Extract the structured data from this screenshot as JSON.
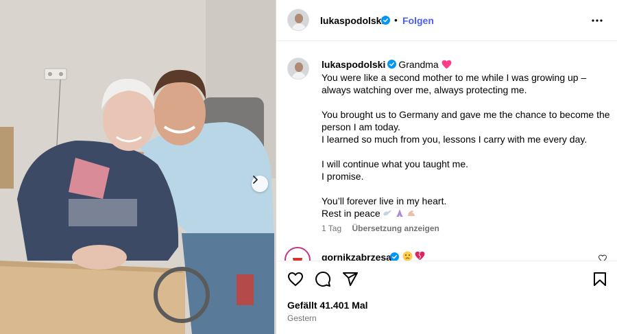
{
  "post": {
    "author": "lukaspodolski",
    "follow_label": "Folgen",
    "separator": "•",
    "caption_title": "Grandma",
    "caption_lines": [
      "You were like a second mother to me while I was growing up –",
      "always watching over me, always protecting me.",
      "",
      "You brought us to Germany and gave me the chance to become the",
      "person I am today.",
      "I learned so much from you, lessons I carry with me every day.",
      "",
      "I will continue what you taught me.",
      "I promise.",
      "",
      "You’ll forever live in my heart.",
      "Rest in peace"
    ],
    "time_ago": "1 Tag",
    "translate_label": "Übersetzung anzeigen"
  },
  "comment": {
    "author": "gornikzabrzesa"
  },
  "footer": {
    "likes": "Gefällt 41.401 Mal",
    "date": "Gestern"
  },
  "colors": {
    "accent": "#4a5df9",
    "verified": "#0095f6",
    "heart": "#ff3b6b",
    "muted": "#737373"
  },
  "icons": [
    "verified-badge-icon",
    "more-options-icon",
    "next-arrow-icon",
    "heart-icon",
    "comment-icon",
    "share-icon",
    "bookmark-icon"
  ]
}
